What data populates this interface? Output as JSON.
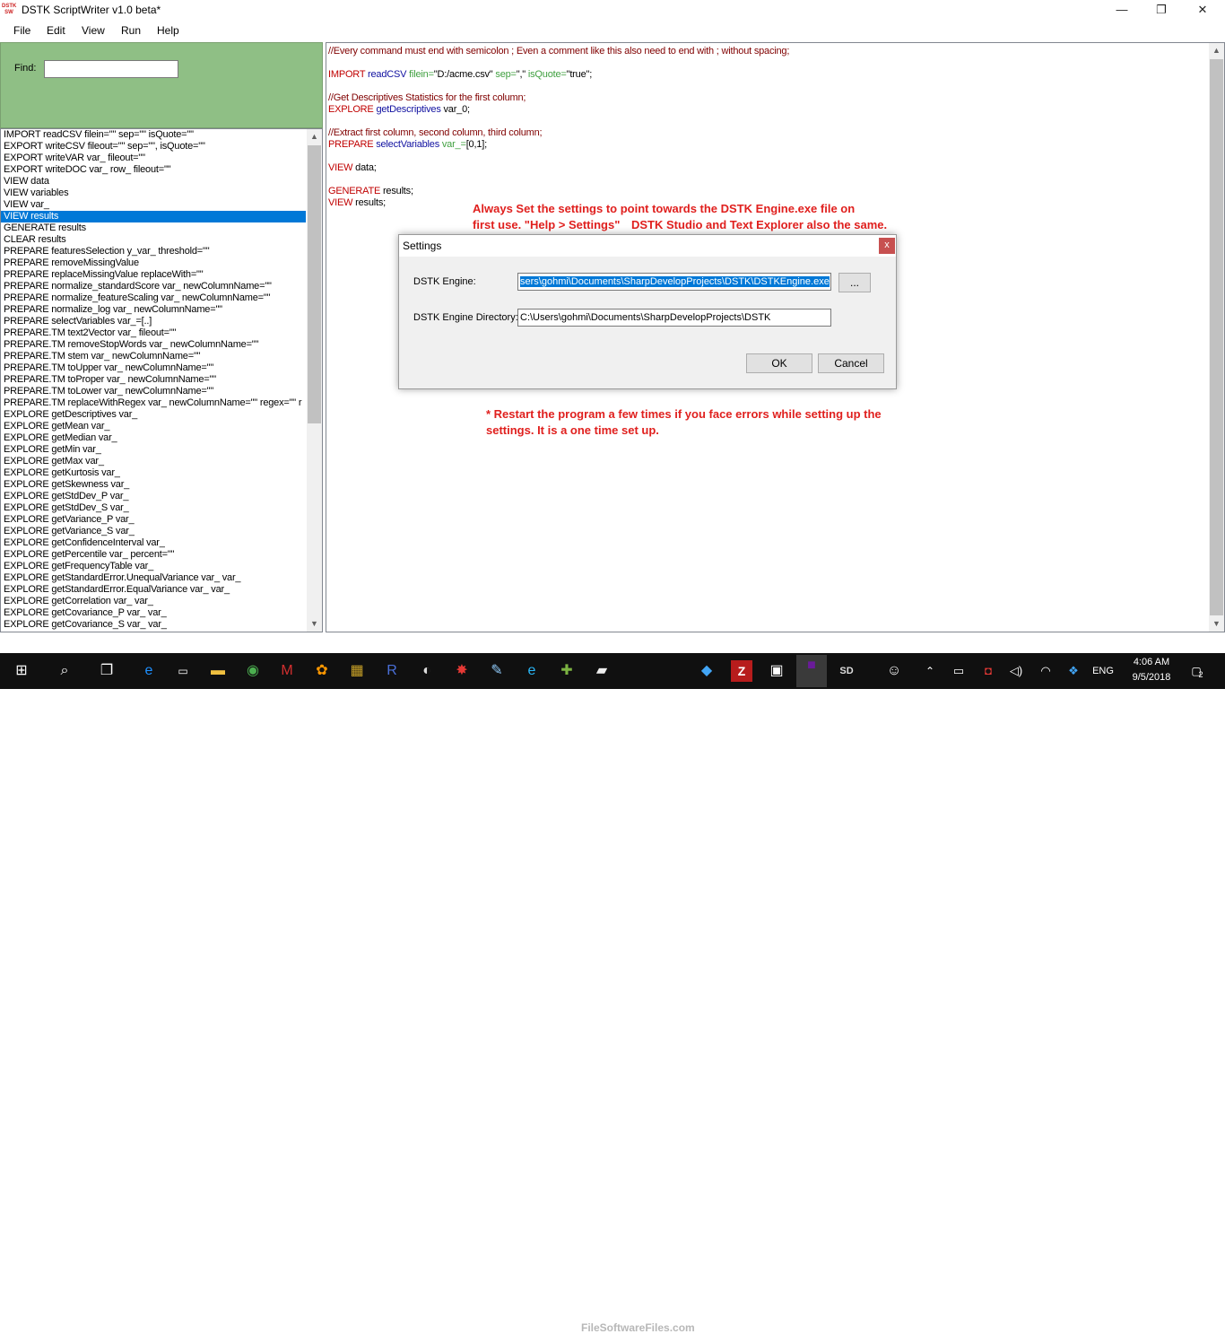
{
  "window": {
    "title": "DSTK ScriptWriter v1.0 beta*",
    "app_icon_text": "DSTK SW",
    "controls": {
      "minimize": "—",
      "maximize": "❐",
      "close": "✕"
    }
  },
  "menu": [
    "File",
    "Edit",
    "View",
    "Run",
    "Help"
  ],
  "find": {
    "label": "Find:",
    "value": ""
  },
  "commands": [
    "IMPORT readCSV filein=\"\" sep=\"\" isQuote=\"\"",
    "EXPORT writeCSV fileout=\"\" sep=\"\", isQuote=\"\"",
    "EXPORT writeVAR var_ fileout=\"\"",
    "EXPORT writeDOC var_ row_ fileout=\"\"",
    "VIEW data",
    "VIEW variables",
    "VIEW var_",
    "VIEW results",
    "GENERATE results",
    "CLEAR results",
    "PREPARE featuresSelection y_var_ threshold=\"\"",
    "PREPARE removeMissingValue",
    "PREPARE replaceMissingValue replaceWith=\"\"",
    "PREPARE normalize_standardScore var_ newColumnName=\"\"",
    "PREPARE normalize_featureScaling var_ newColumnName=\"\"",
    "PREPARE normalize_log var_ newColumnName=\"\"",
    "PREPARE selectVariables var_=[..]",
    "PREPARE.TM text2Vector var_ fileout=\"\"",
    "PREPARE.TM removeStopWords var_ newColumnName=\"\"",
    "PREPARE.TM stem var_ newColumnName=\"\"",
    "PREPARE.TM toUpper var_ newColumnName=\"\"",
    "PREPARE.TM toProper var_ newColumnName=\"\"",
    "PREPARE.TM toLower var_ newColumnName=\"\"",
    "PREPARE.TM replaceWithRegex var_ newColumnName=\"\" regex=\"\" r",
    "EXPLORE getDescriptives var_",
    "EXPLORE getMean var_",
    "EXPLORE getMedian var_",
    "EXPLORE getMin var_",
    "EXPLORE getMax var_",
    "EXPLORE getKurtosis var_",
    "EXPLORE getSkewness var_",
    "EXPLORE getStdDev_P var_",
    "EXPLORE getStdDev_S var_",
    "EXPLORE getVariance_P var_",
    "EXPLORE getVariance_S var_",
    "EXPLORE getConfidenceInterval var_",
    "EXPLORE getPercentile var_ percent=\"\"",
    "EXPLORE getFrequencyTable var_",
    "EXPLORE getStandardError.UnequalVariance var_ var_",
    "EXPLORE getStandardError.EqualVariance var_ var_",
    "EXPLORE getCorrelation var_ var_",
    "EXPLORE getCovariance_P var_ var_",
    "EXPLORE getCovariance_S var_ var_"
  ],
  "selected_command_index": 7,
  "editor": {
    "comment1": "//Every command must end with semicolon ; Even a comment like this also need to end with ; without spacing;",
    "l2_kw": "IMPORT",
    "l2_fn": "readCSV",
    "l2_a1": "filein=",
    "l2_v1": "\"D:/acme.csv\"",
    "l2_a2": "sep=",
    "l2_v2": "\",\"",
    "l2_a3": "isQuote=",
    "l2_v3": "\"true\";",
    "comment2": "//Get Descriptives Statistics for the first column;",
    "l4_kw": "EXPLORE",
    "l4_fn": "getDescriptives",
    "l4_rest": "var_0;",
    "comment3": "//Extract first column, second column, third column;",
    "l6_kw": "PREPARE",
    "l6_fn": "selectVariables",
    "l6_a": "var_=",
    "l6_rest": "[0,1];",
    "l7_kw": "VIEW",
    "l7_rest": "data;",
    "l8_kw": "GENERATE",
    "l8_rest": "results;",
    "l9_kw": "VIEW",
    "l9_rest": "results;"
  },
  "notes": {
    "n1_a": "Always Set the settings to point towards the DSTK Engine.exe file on",
    "n1_b": "first use. \"Help > Settings\"",
    "n1_c": "DSTK Studio and Text Explorer also the same.",
    "n2_a": "* Restart the program a few times if you face errors while setting up the",
    "n2_b": "settings. It is a one time set up."
  },
  "settings_dialog": {
    "title": "Settings",
    "close": "x",
    "engine_label": "DSTK Engine:",
    "engine_value": "sers\\gohmi\\Documents\\SharpDevelopProjects\\DSTK\\DSTKEngine.exe",
    "browse_label": "...",
    "dir_label": "DSTK Engine Directory:",
    "dir_value": "C:\\Users\\gohmi\\Documents\\SharpDevelopProjects\\DSTK",
    "ok_label": "OK",
    "cancel_label": "Cancel"
  },
  "taskbar": {
    "time": "4:06 AM",
    "date": "9/5/2018",
    "lang": "ENG",
    "notifications": "2",
    "watermark": "FileSoftwareFiles.com",
    "pinned_icons": [
      "windows-start-icon",
      "search-icon",
      "task-view-icon",
      "edge-icon",
      "cmd-icon",
      "file-explorer-icon",
      "chrome-icon",
      "mcafee-icon",
      "app-orange-icon",
      "winrar-icon",
      "r-icon",
      "app-circle-icon",
      "network-icon",
      "paint-icon",
      "ie-icon",
      "app-green-icon",
      "media-icon",
      "app-blue-icon",
      "filezilla-icon",
      "app-window-icon",
      "dstk-studio-icon",
      "sharpdevelop-icon"
    ]
  }
}
